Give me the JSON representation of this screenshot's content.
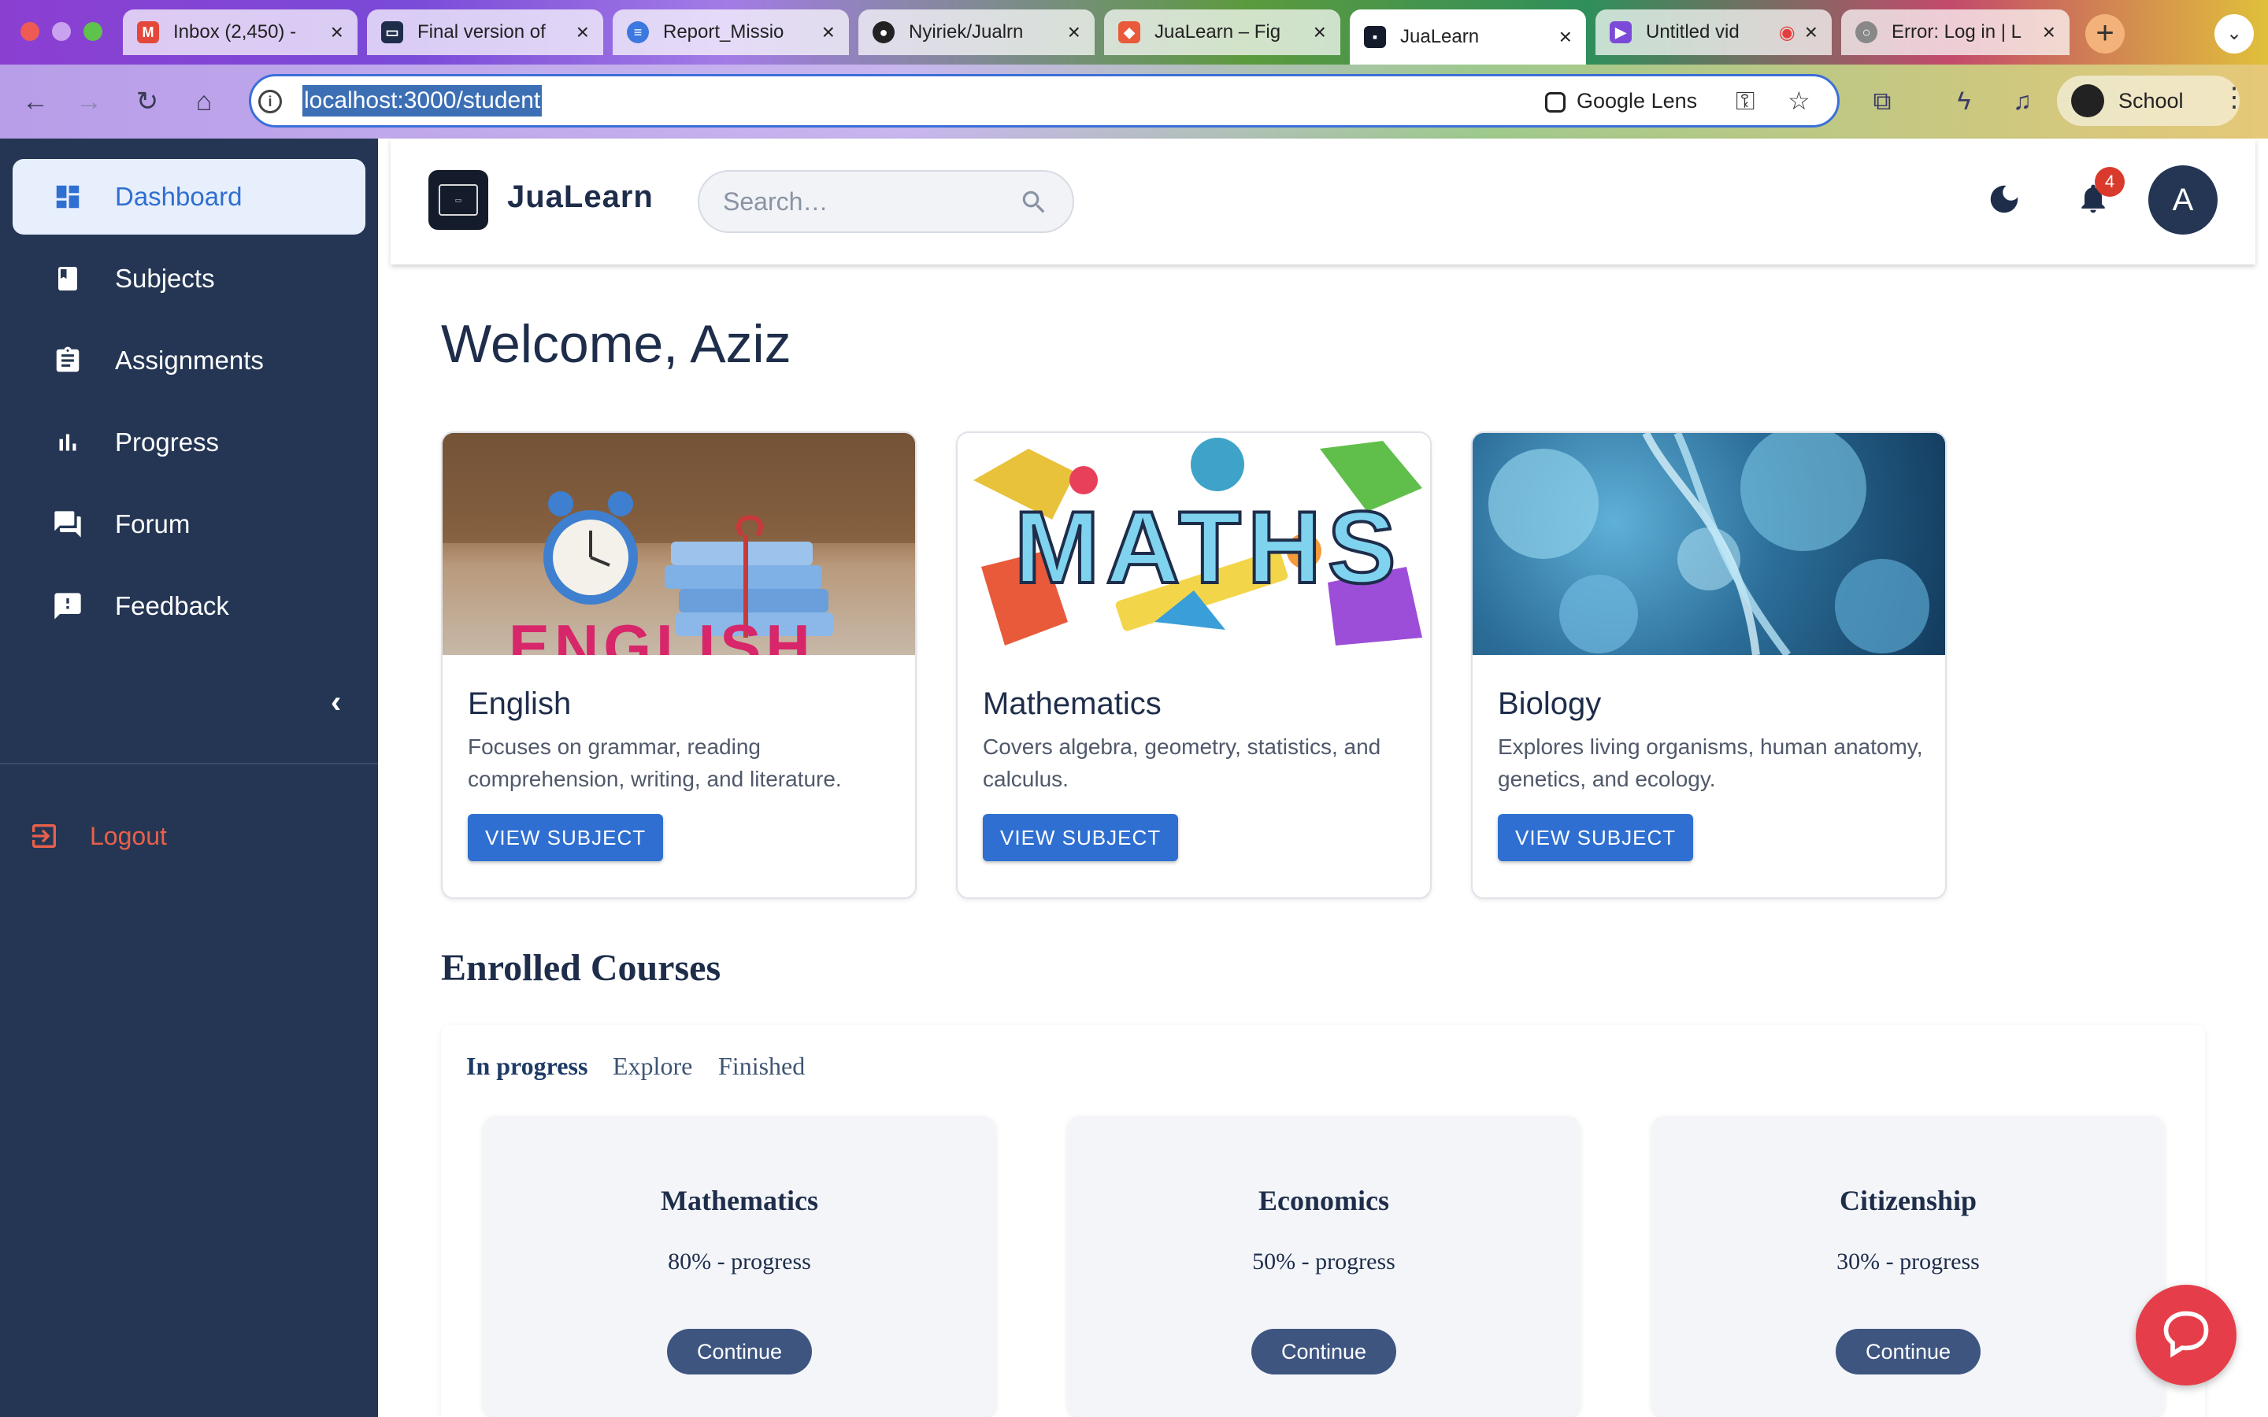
{
  "browser": {
    "tabs": [
      {
        "label": "Inbox (2,450) -",
        "icon": "gmail-icon",
        "color": "#e4483a"
      },
      {
        "label": "Final version of",
        "icon": "doc-icon",
        "color": "#1e2d4a"
      },
      {
        "label": "Report_Missio",
        "icon": "docs-icon",
        "color": "#3c78e0"
      },
      {
        "label": "Nyiriek/Jualrn",
        "icon": "github-icon",
        "color": "#222222"
      },
      {
        "label": "JuaLearn – Fig",
        "icon": "figma-icon",
        "color": "#e85a3a"
      },
      {
        "label": "JuaLearn",
        "icon": "jualearn-icon",
        "color": "#141c2b"
      },
      {
        "label": "Untitled vid",
        "icon": "video-icon",
        "color": "#7c4ad8"
      },
      {
        "label": "Error: Log in | L",
        "icon": "globe-icon",
        "color": "#888888"
      }
    ],
    "url": "localhost:3000/student",
    "google_lens": "Google Lens",
    "profile_name": "School"
  },
  "sidebar": {
    "items": [
      {
        "label": "Dashboard",
        "icon": "dashboard-icon"
      },
      {
        "label": "Subjects",
        "icon": "book-icon"
      },
      {
        "label": "Assignments",
        "icon": "clipboard-icon"
      },
      {
        "label": "Progress",
        "icon": "bar-chart-icon"
      },
      {
        "label": "Forum",
        "icon": "forum-icon"
      },
      {
        "label": "Feedback",
        "icon": "feedback-icon"
      }
    ],
    "logout": "Logout"
  },
  "header": {
    "brand": "JuaLearn",
    "search_placeholder": "Search…",
    "notification_count": "4",
    "avatar_initial": "A"
  },
  "main": {
    "welcome": "Welcome, Aziz",
    "subjects": [
      {
        "title": "English",
        "description": "Focuses on grammar, reading comprehension, writing, and literature.",
        "button": "VIEW SUBJECT",
        "image_text": "ENGLISH"
      },
      {
        "title": "Mathematics",
        "description": "Covers algebra, geometry, statistics, and calculus.",
        "button": "VIEW SUBJECT",
        "image_text": "MATHS"
      },
      {
        "title": "Biology",
        "description": "Explores living organisms, human anatomy, genetics, and ecology.",
        "button": "VIEW SUBJECT"
      }
    ],
    "enrolled_title": "Enrolled Courses",
    "tabs": [
      "In progress",
      "Explore",
      "Finished"
    ],
    "courses": [
      {
        "name": "Mathematics",
        "progress": "80% - progress",
        "button": "Continue"
      },
      {
        "name": "Economics",
        "progress": "50% - progress",
        "button": "Continue"
      },
      {
        "name": "Citizenship",
        "progress": "30% - progress",
        "button": "Continue"
      }
    ]
  },
  "colors": {
    "sidebar_bg": "#243654",
    "accent": "#2f6fd1",
    "logout": "#e8604a",
    "chat_fab": "#e53e4a"
  }
}
